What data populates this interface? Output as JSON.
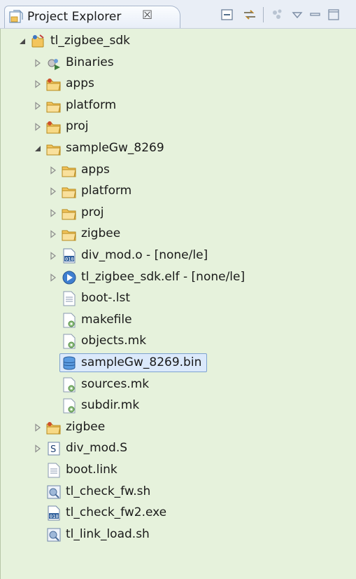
{
  "view": {
    "title": "Project Explorer",
    "close_glyph": "☒"
  },
  "toolbar": {
    "buttons": [
      "collapse-all-icon",
      "link-with-editor-icon",
      "customize-view-icon",
      "view-menu-icon",
      "minimize-icon"
    ]
  },
  "colors": {
    "tree_background": "#e6f2dc",
    "selection_background": "#dbe9fb",
    "selection_border": "#7da2ce",
    "folder": "#f2c25a",
    "tab_background": "#e9eef6"
  },
  "tree": [
    {
      "label": "tl_zigbee_sdk",
      "icon": "project-icon",
      "twisty": "expanded",
      "level": 0
    },
    {
      "label": "Binaries",
      "icon": "binaries-icon",
      "twisty": "collapsed",
      "level": 1
    },
    {
      "label": "apps",
      "icon": "source-folder-icon",
      "twisty": "collapsed",
      "level": 1
    },
    {
      "label": "platform",
      "icon": "folder-icon",
      "twisty": "collapsed",
      "level": 1
    },
    {
      "label": "proj",
      "icon": "source-folder-icon",
      "twisty": "collapsed",
      "level": 1
    },
    {
      "label": "sampleGw_8269",
      "icon": "folder-icon",
      "twisty": "expanded",
      "level": 1
    },
    {
      "label": "apps",
      "icon": "folder-icon",
      "twisty": "collapsed",
      "level": 2
    },
    {
      "label": "platform",
      "icon": "folder-icon",
      "twisty": "collapsed",
      "level": 2
    },
    {
      "label": "proj",
      "icon": "folder-icon",
      "twisty": "collapsed",
      "level": 2
    },
    {
      "label": "zigbee",
      "icon": "folder-icon",
      "twisty": "collapsed",
      "level": 2
    },
    {
      "label": "div_mod.o - [none/le]",
      "icon": "object-file-icon",
      "twisty": "collapsed",
      "level": 2
    },
    {
      "label": "tl_zigbee_sdk.elf - [none/le]",
      "icon": "executable-icon",
      "twisty": "collapsed",
      "level": 2
    },
    {
      "label": "boot-.lst",
      "icon": "text-file-icon",
      "twisty": "none",
      "level": 2
    },
    {
      "label": "makefile",
      "icon": "make-file-icon",
      "twisty": "none",
      "level": 2
    },
    {
      "label": "objects.mk",
      "icon": "make-file-icon",
      "twisty": "none",
      "level": 2
    },
    {
      "label": "sampleGw_8269.bin",
      "icon": "database-icon",
      "twisty": "none",
      "level": 2,
      "selected": true
    },
    {
      "label": "sources.mk",
      "icon": "make-file-icon",
      "twisty": "none",
      "level": 2
    },
    {
      "label": "subdir.mk",
      "icon": "make-file-icon",
      "twisty": "none",
      "level": 2
    },
    {
      "label": "zigbee",
      "icon": "source-folder-icon",
      "twisty": "collapsed",
      "level": 1
    },
    {
      "label": "div_mod.S",
      "icon": "asm-file-icon",
      "twisty": "collapsed",
      "level": 1
    },
    {
      "label": "boot.link",
      "icon": "text-file-icon",
      "twisty": "none",
      "level": 1
    },
    {
      "label": "tl_check_fw.sh",
      "icon": "script-file-icon",
      "twisty": "none",
      "level": 1
    },
    {
      "label": "tl_check_fw2.exe",
      "icon": "binary-file-icon",
      "twisty": "none",
      "level": 1
    },
    {
      "label": "tl_link_load.sh",
      "icon": "script-file-icon",
      "twisty": "none",
      "level": 1
    }
  ]
}
